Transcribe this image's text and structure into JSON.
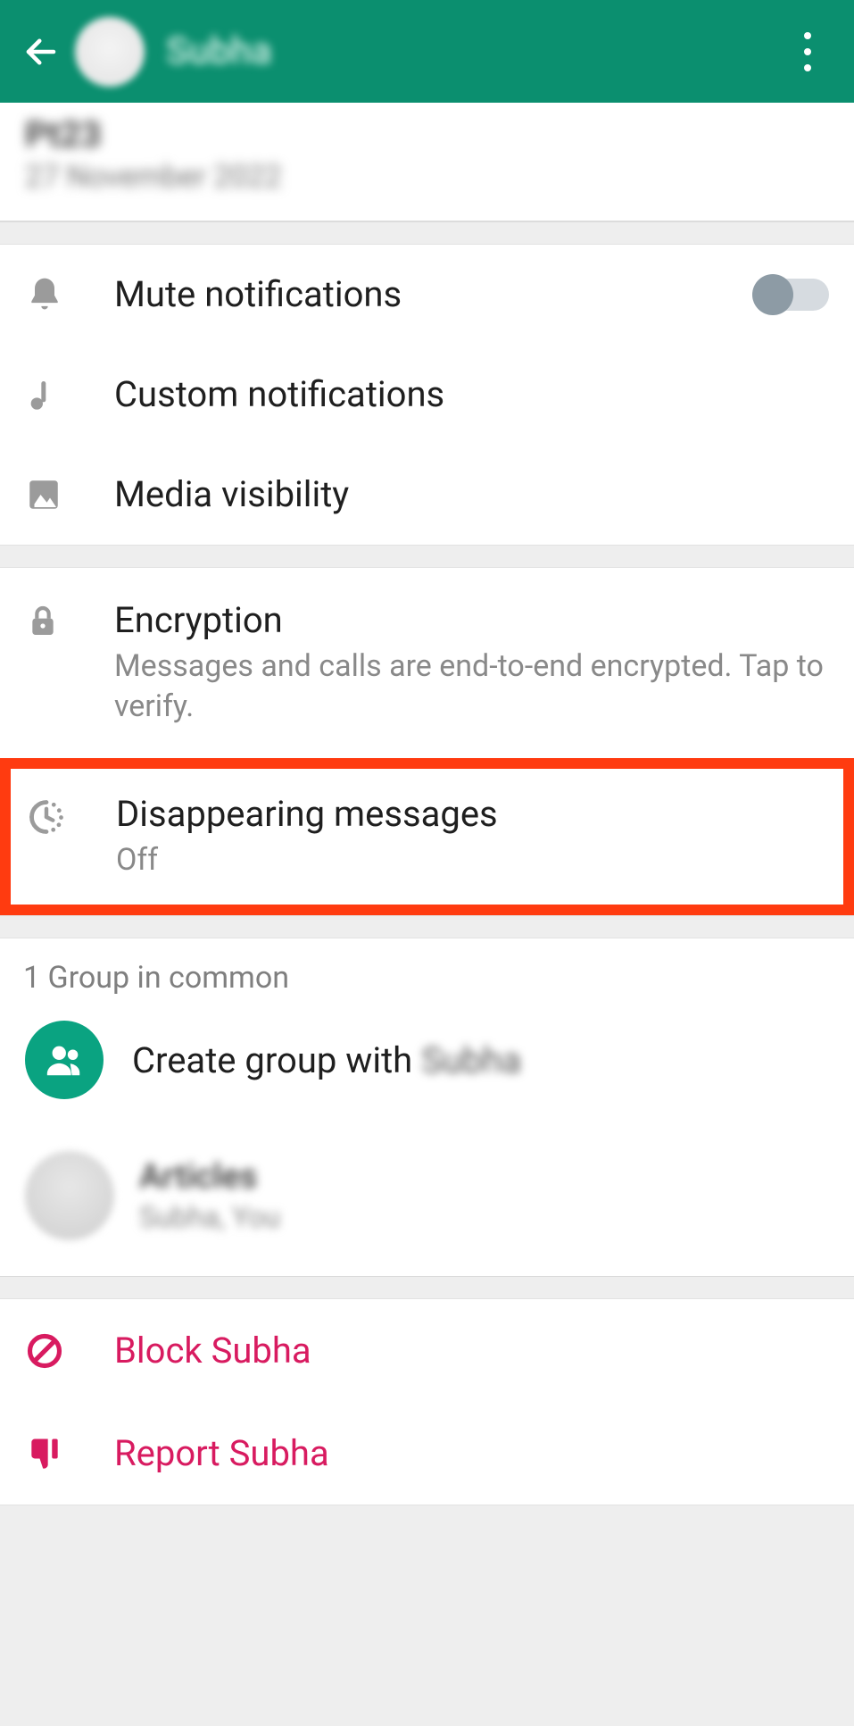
{
  "toolbar": {
    "contact_name": "Subha"
  },
  "info": {
    "line1": "Pt23",
    "line2": "27 November 2022"
  },
  "settings": {
    "mute_label": "Mute notifications",
    "mute_on": false,
    "custom_notifications_label": "Custom notifications",
    "media_visibility_label": "Media visibility"
  },
  "privacy": {
    "encryption_title": "Encryption",
    "encryption_subtitle": "Messages and calls are end-to-end encrypted. Tap to verify.",
    "disappearing_title": "Disappearing messages",
    "disappearing_value": "Off"
  },
  "groups": {
    "header": "1 Group in common",
    "create_prefix": "Create group with ",
    "create_name": "Subha",
    "group_name": "Articles",
    "group_members": "Subha, You"
  },
  "danger": {
    "block_label": "Block Subha",
    "report_label": "Report Subha"
  }
}
